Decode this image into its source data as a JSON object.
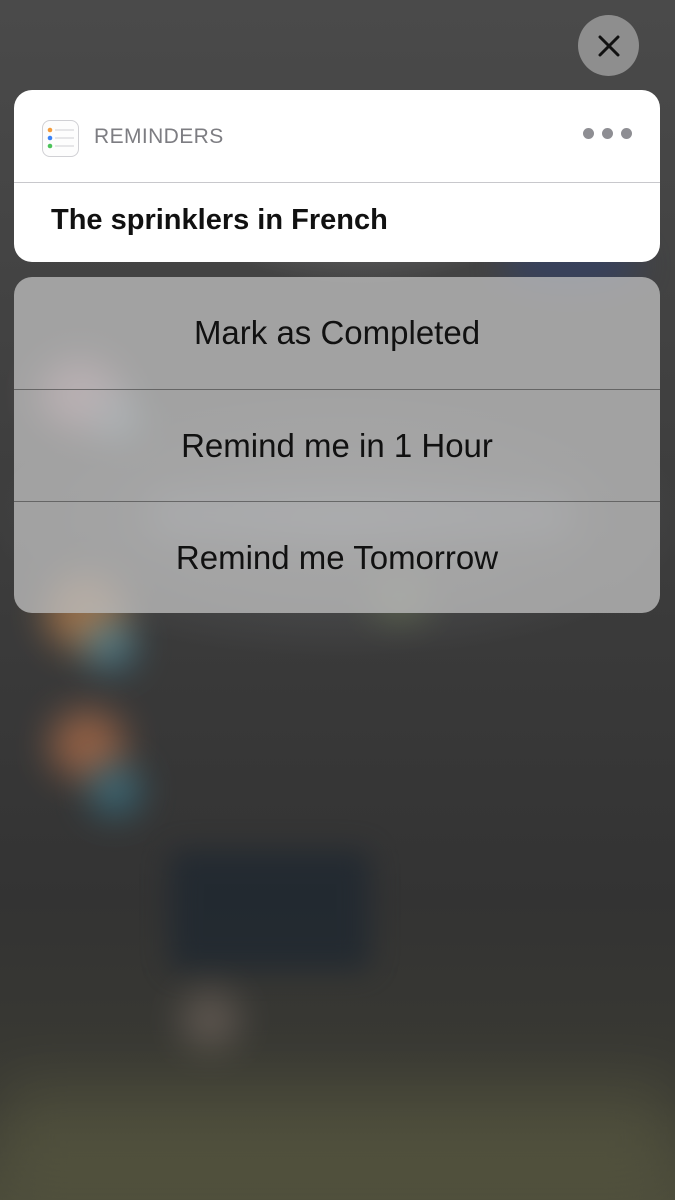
{
  "close": {
    "icon": "close-icon"
  },
  "notification": {
    "app_icon": "reminders-app-icon",
    "app_name": "REMINDERS",
    "more_icon": "more-icon",
    "title": "The sprinklers in French"
  },
  "actions": [
    {
      "label": "Mark as Completed"
    },
    {
      "label": "Remind me in 1 Hour"
    },
    {
      "label": "Remind me Tomorrow"
    }
  ],
  "colors": {
    "card_background": "#ffffff",
    "action_background": "#bebebe",
    "close_button": "#8e8e8e"
  }
}
